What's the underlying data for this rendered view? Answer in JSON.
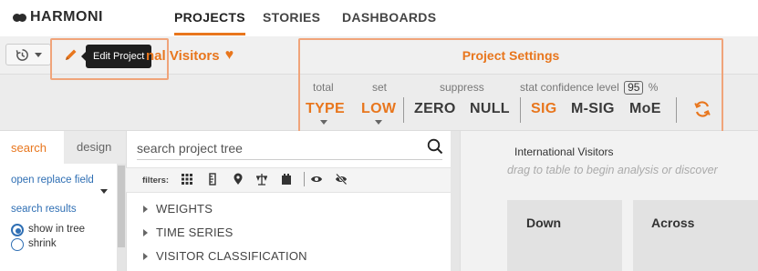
{
  "brand": {
    "name": "HARMONI"
  },
  "nav": {
    "tabs": [
      {
        "label": "PROJECTS",
        "active": true
      },
      {
        "label": "STORIES",
        "active": false
      },
      {
        "label": "DASHBOARDS",
        "active": false
      }
    ]
  },
  "toolbar": {
    "history_icon": "history-icon",
    "tooltip": "Edit Project",
    "project_title": "nal Visitors",
    "favorite_icon": "heart-icon"
  },
  "settings": {
    "title": "Project Settings",
    "total_label": "total",
    "set_label": "set",
    "suppress_label": "suppress",
    "confidence_label": "stat confidence level",
    "confidence_value": "95",
    "confidence_unit": "%",
    "options": {
      "type": "TYPE",
      "low": "LOW",
      "zero": "ZERO",
      "null": "NULL",
      "sig": "SIG",
      "msig": "M-SIG",
      "moe": "MoE"
    },
    "refresh_icon": "refresh-icon",
    "accent": "#e8761d"
  },
  "left": {
    "tab_search": "search",
    "tab_design": "design",
    "open_replace": "open replace field",
    "search_results": "search results",
    "radio_show": "show in tree",
    "radio_shrink": "shrink"
  },
  "tree": {
    "search_placeholder": "search project tree",
    "filters_label": "filters:",
    "items": [
      "WEIGHTS",
      "TIME SERIES",
      "VISITOR CLASSIFICATION"
    ]
  },
  "right": {
    "name": "International Visitors",
    "hint": "drag to table to begin analysis or discover",
    "down": "Down",
    "across": "Across"
  }
}
